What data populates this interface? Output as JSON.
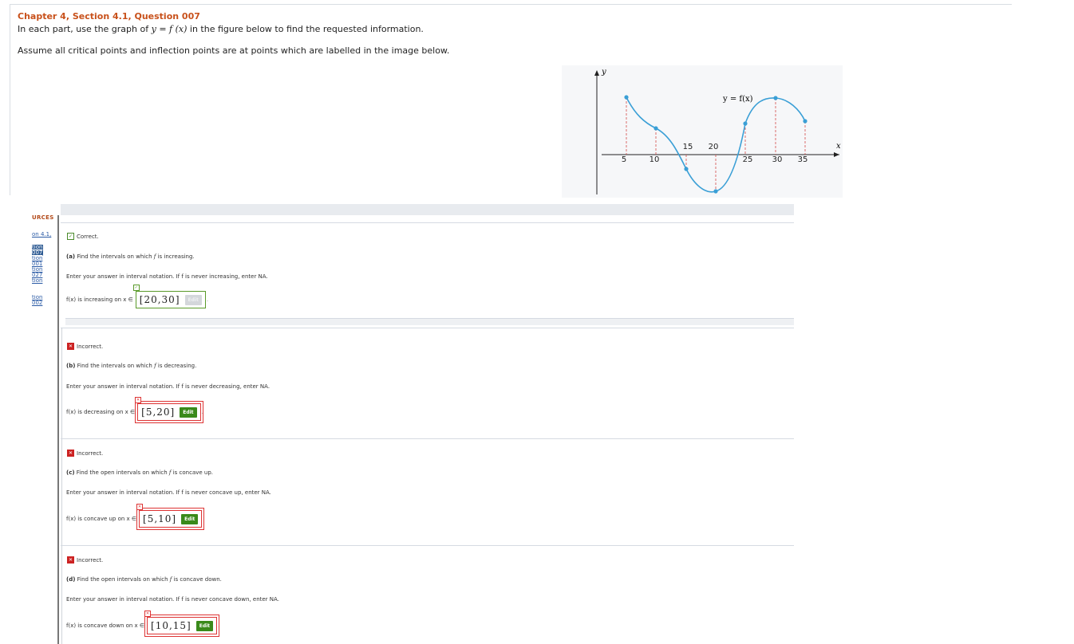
{
  "header": {
    "title": "Chapter 4, Section 4.1, Question 007",
    "instruction_pre": "In each part, use the graph of ",
    "instruction_math": "y = f (x)",
    "instruction_post": " in the figure below to find the requested information.",
    "assumption": "Assume all critical points and inflection points are at points which are labelled in the image below."
  },
  "graph": {
    "y_label": "y",
    "x_label": "x",
    "curve_label": "y = f(x)",
    "x_ticks_below": [
      "5",
      "10",
      "25",
      "30",
      "35"
    ],
    "x_ticks_above": [
      "15",
      "20"
    ],
    "curve_color": "#3a9fd6",
    "guide_color": "#d24a4a"
  },
  "sidebar": {
    "header": "URCES",
    "items": [
      "on 4.1,",
      "tion",
      "007",
      "tion",
      "001",
      "tion",
      "027",
      "tion",
      "tion",
      "002"
    ]
  },
  "parts": [
    {
      "status": "Correct.",
      "prompt_letter": "(a)",
      "prompt_pre": " Find the intervals on which ",
      "prompt_post": " is increasing.",
      "hint": "Enter your answer in interval notation. If f is never increasing, enter NA.",
      "answer_label": "f(x) is increasing on x ∈",
      "answer": "[20,30]",
      "edit": "Edit"
    },
    {
      "status": "Incorrect.",
      "prompt_letter": "(b)",
      "prompt_pre": " Find the intervals on which ",
      "prompt_post": " is decreasing.",
      "hint": "Enter your answer in interval notation. If f is never decreasing, enter NA.",
      "answer_label": "f(x) is decreasing on x ∈",
      "answer": "[5,20]",
      "edit": "Edit"
    },
    {
      "status": "Incorrect.",
      "prompt_letter": "(c)",
      "prompt_pre": " Find the open intervals on which ",
      "prompt_post": " is concave up.",
      "hint": "Enter your answer in interval notation. If f is never concave up, enter NA.",
      "answer_label": "f(x) is concave up on x ∈",
      "answer": "[5,10]",
      "edit": "Edit"
    },
    {
      "status": "Incorrect.",
      "prompt_letter": "(d)",
      "prompt_pre": " Find the open intervals on which ",
      "prompt_post": " is concave down.",
      "hint": "Enter your answer in interval notation. If f is never concave down, enter NA.",
      "answer_label": "f(x) is concave down on x ∈",
      "answer": "[10,15]",
      "edit": "Edit"
    }
  ],
  "f_symbol": "f"
}
